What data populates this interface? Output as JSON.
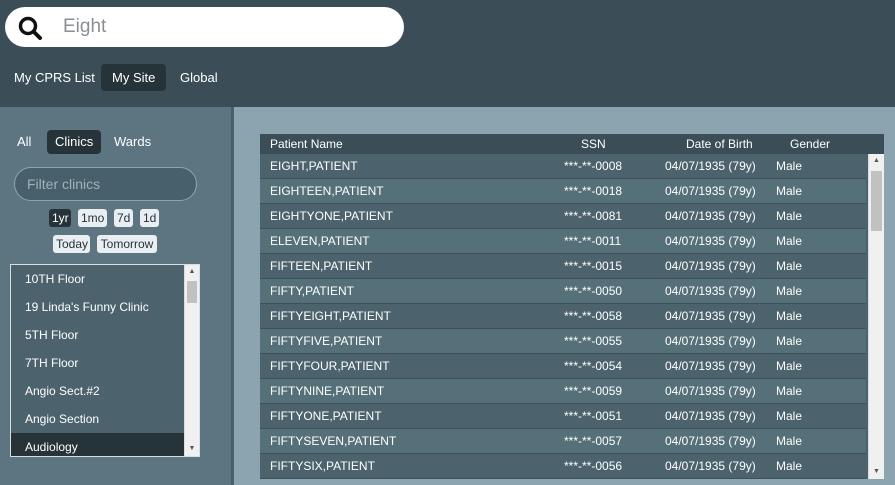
{
  "search": {
    "value": "Eight",
    "icon": "search-icon"
  },
  "scopes": [
    {
      "label": "My CPRS List",
      "active": false
    },
    {
      "label": "My Site",
      "active": true
    },
    {
      "label": "Global",
      "active": false
    }
  ],
  "location_tabs": [
    {
      "label": "All",
      "active": false
    },
    {
      "label": "Clinics",
      "active": true
    },
    {
      "label": "Wards",
      "active": false
    }
  ],
  "filter": {
    "placeholder": "Filter clinics",
    "value": ""
  },
  "date_ranges": [
    {
      "label": "1yr",
      "active": true
    },
    {
      "label": "1mo",
      "active": false
    },
    {
      "label": "7d",
      "active": false
    },
    {
      "label": "1d",
      "active": false
    },
    {
      "label": "Today",
      "active": false
    },
    {
      "label": "Tomorrow",
      "active": false
    }
  ],
  "clinics": [
    {
      "label": "10TH Floor",
      "selected": false
    },
    {
      "label": "19 Linda's Funny Clinic",
      "selected": false
    },
    {
      "label": "5TH Floor",
      "selected": false
    },
    {
      "label": "7TH Floor",
      "selected": false
    },
    {
      "label": "Angio Sect.#2",
      "selected": false
    },
    {
      "label": "Angio Section",
      "selected": false
    },
    {
      "label": "Audiology",
      "selected": true
    }
  ],
  "table": {
    "columns": [
      "Patient Name",
      "SSN",
      "Date of Birth",
      "Gender"
    ],
    "rows": [
      [
        "EIGHT,PATIENT",
        "***-**-0008",
        "04/07/1935 (79y)",
        "Male"
      ],
      [
        "EIGHTEEN,PATIENT",
        "***-**-0018",
        "04/07/1935 (79y)",
        "Male"
      ],
      [
        "EIGHTYONE,PATIENT",
        "***-**-0081",
        "04/07/1935 (79y)",
        "Male"
      ],
      [
        "ELEVEN,PATIENT",
        "***-**-0011",
        "04/07/1935 (79y)",
        "Male"
      ],
      [
        "FIFTEEN,PATIENT",
        "***-**-0015",
        "04/07/1935 (79y)",
        "Male"
      ],
      [
        "FIFTY,PATIENT",
        "***-**-0050",
        "04/07/1935 (79y)",
        "Male"
      ],
      [
        "FIFTYEIGHT,PATIENT",
        "***-**-0058",
        "04/07/1935 (79y)",
        "Male"
      ],
      [
        "FIFTYFIVE,PATIENT",
        "***-**-0055",
        "04/07/1935 (79y)",
        "Male"
      ],
      [
        "FIFTYFOUR,PATIENT",
        "***-**-0054",
        "04/07/1935 (79y)",
        "Male"
      ],
      [
        "FIFTYNINE,PATIENT",
        "***-**-0059",
        "04/07/1935 (79y)",
        "Male"
      ],
      [
        "FIFTYONE,PATIENT",
        "***-**-0051",
        "04/07/1935 (79y)",
        "Male"
      ],
      [
        "FIFTYSEVEN,PATIENT",
        "***-**-0057",
        "04/07/1935 (79y)",
        "Male"
      ],
      [
        "FIFTYSIX,PATIENT",
        "***-**-0056",
        "04/07/1935 (79y)",
        "Male"
      ]
    ]
  },
  "colors": {
    "header_bg": "#3b4e58",
    "active_tab_bg": "#263339",
    "left_panel_bg": "#5c7580",
    "right_panel_bg": "#8ca4b0"
  }
}
